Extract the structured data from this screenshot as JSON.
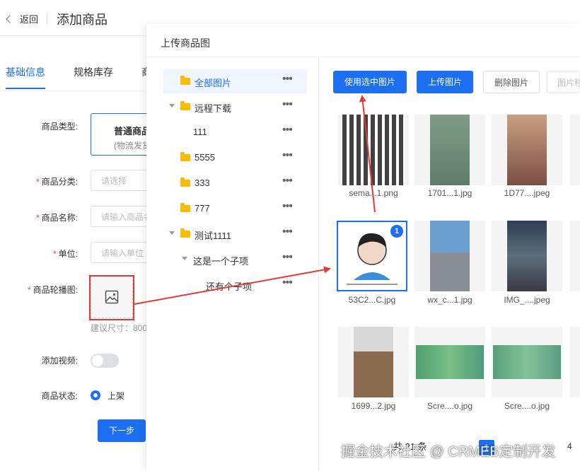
{
  "header": {
    "back_label": "返回",
    "title": "添加商品"
  },
  "tabs": [
    {
      "label": "基础信息",
      "active": true
    },
    {
      "label": "规格库存",
      "active": false
    },
    {
      "label": "商",
      "active": false
    }
  ],
  "form": {
    "type_label": "商品类型:",
    "type_card_title": "普通商品",
    "type_card_sub": "(物流发货",
    "category_label": "商品分类:",
    "category_placeholder": "请选择",
    "name_label": "商品名称:",
    "name_placeholder": "请输入商品名",
    "unit_label": "单位:",
    "unit_placeholder": "请输入单位",
    "carousel_label": "商品轮播图:",
    "carousel_hint": "建议尺寸：800",
    "video_label": "添加视频:",
    "status_label": "商品状态:",
    "status_option": "上架",
    "next_button": "下一步"
  },
  "modal": {
    "title": "上传商品图",
    "tree": [
      {
        "label": "全部图片",
        "selected": true,
        "has_folder": true,
        "expandable": false
      },
      {
        "label": "远程下载",
        "selected": false,
        "has_folder": true,
        "expandable": true
      },
      {
        "label": "111",
        "selected": false,
        "has_folder": false,
        "expandable": false
      },
      {
        "label": "5555",
        "selected": false,
        "has_folder": true,
        "expandable": false
      },
      {
        "label": "333",
        "selected": false,
        "has_folder": true,
        "expandable": false
      },
      {
        "label": "777",
        "selected": false,
        "has_folder": true,
        "expandable": false
      },
      {
        "label": "测试1111",
        "selected": false,
        "has_folder": true,
        "expandable": true
      },
      {
        "label": "这是一个子项",
        "selected": false,
        "has_folder": false,
        "expandable": true
      },
      {
        "label": "还有个子项",
        "selected": false,
        "has_folder": false,
        "expandable": false
      }
    ],
    "more_icon": "•••",
    "buttons": {
      "use_selected": "使用选中图片",
      "upload": "上传图片",
      "delete": "删除图片",
      "move": "图片移动"
    },
    "images": [
      {
        "caption": "sema...1.png",
        "selected": false,
        "color": "#2b2b2b"
      },
      {
        "caption": "1701...1.jpg",
        "selected": false,
        "color": "#6f8f7a"
      },
      {
        "caption": "1D77....jpeg",
        "selected": false,
        "color": "#a07a6a"
      },
      {
        "caption": "53C2...C.jpg",
        "selected": true,
        "badge": "1",
        "color": "#e8d8cc"
      },
      {
        "caption": "wx_c...1.jpg",
        "selected": false,
        "color": "#6f8fae"
      },
      {
        "caption": "IMG_....jpeg",
        "selected": false,
        "color": "#4a5d6e"
      },
      {
        "caption": "1699...2.jpg",
        "selected": false,
        "color": "#9b7b5f"
      },
      {
        "caption": "Scre....o.jpg",
        "selected": false,
        "color": "#5f9f7a"
      },
      {
        "caption": "Scre....o.jpg",
        "selected": false,
        "color": "#6aa088"
      }
    ],
    "total_text": "共 21 条",
    "current_page": "1",
    "next_page": "4"
  },
  "watermark": "掘金技术社区 @ CRMEB定制开发",
  "colors": {
    "primary": "#1d6ff2",
    "annotation": "#e53935",
    "folder": "#fbbc05"
  }
}
